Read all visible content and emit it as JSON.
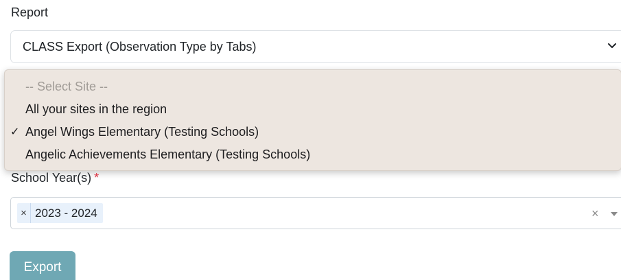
{
  "report": {
    "label": "Report",
    "selected": "CLASS Export (Observation Type by Tabs)"
  },
  "site_dropdown": {
    "options": [
      "-- Select Site --",
      "All your sites in the region",
      "Angel Wings Elementary (Testing Schools)",
      "Angelic Achievements Elementary (Testing Schools)"
    ],
    "checked_mark": "✓",
    "checked_index": 2
  },
  "school_year": {
    "label": "School Year(s)",
    "required_mark": "*",
    "tag_remove": "×",
    "tags": [
      "2023 - 2024"
    ],
    "clear_all": "×"
  },
  "export": {
    "label": "Export"
  },
  "colors": {
    "accent_button": "#6fa8b4",
    "required": "#dc3545",
    "dropdown_bg": "#ede6e0",
    "tag_bg": "#e8f1fb"
  },
  "icons": {
    "report_chevron": "chevron-down-icon",
    "check": "checkmark-icon",
    "clear": "close-icon",
    "caret": "caret-down-icon"
  }
}
